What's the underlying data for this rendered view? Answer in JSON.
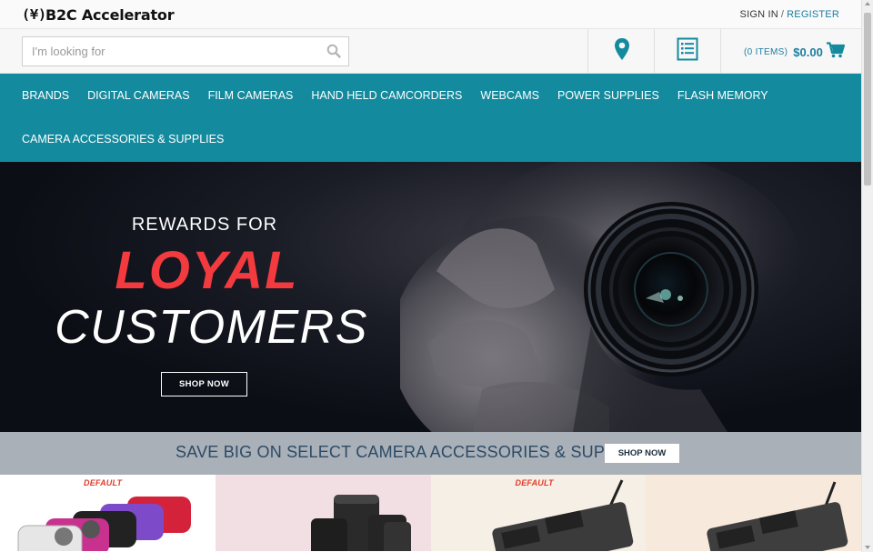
{
  "brand": {
    "logo_mark": "(¥)",
    "name": "B2C Accelerator"
  },
  "account": {
    "sign_in": "SIGN IN",
    "separator": "/",
    "register": "REGISTER"
  },
  "search": {
    "placeholder": "I'm looking for",
    "value": ""
  },
  "icons": {
    "search": "search-icon",
    "store_locator": "map-pin-icon",
    "quick_order": "list-icon",
    "cart": "shopping-cart-icon"
  },
  "cart": {
    "items_label": "(0 ITEMS)",
    "total": "$0.00"
  },
  "nav": {
    "items": [
      "BRANDS",
      "DIGITAL CAMERAS",
      "FILM CAMERAS",
      "HAND HELD CAMCORDERS",
      "WEBCAMS",
      "POWER SUPPLIES",
      "FLASH MEMORY",
      "CAMERA ACCESSORIES & SUPPLIES"
    ]
  },
  "hero": {
    "line1": "REWARDS FOR",
    "line2": "LOYAL",
    "line3": "CUSTOMERS",
    "cta": "SHOP NOW"
  },
  "promo": {
    "text": "SAVE BIG ON SELECT CAMERA ACCESSORIES & SUPPLIES",
    "cta": "SHOP NOW"
  },
  "tiles": {
    "badge": "DEFAULT"
  },
  "colors": {
    "accent": "#138a9e",
    "link": "#1a7ea0",
    "loyal_red": "#f23a3f",
    "promo_bg": "#a9b0b8",
    "promo_text": "#2d4a66"
  }
}
